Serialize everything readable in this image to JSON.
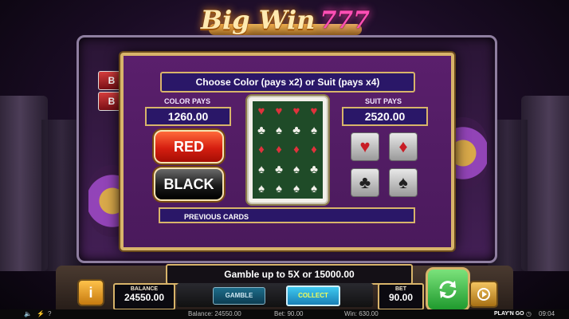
{
  "logo": {
    "text": "Big Win",
    "sevens": "777"
  },
  "side_tiles": [
    "B",
    "B"
  ],
  "panel": {
    "title": "Choose Color (pays x2) or Suit (pays x4)",
    "color_pays_label": "COLOR PAYS",
    "color_pays_value": "1260.00",
    "suit_pays_label": "SUIT PAYS",
    "suit_pays_value": "2520.00",
    "red_label": "RED",
    "black_label": "BLACK",
    "previous_cards_label": "PREVIOUS CARDS",
    "suits": [
      {
        "name": "hearts",
        "glyph": "♥",
        "color": "#c81d25"
      },
      {
        "name": "diamonds",
        "glyph": "♦",
        "color": "#c81d25"
      },
      {
        "name": "clubs",
        "glyph": "♣",
        "color": "#222222"
      },
      {
        "name": "spades",
        "glyph": "♠",
        "color": "#222222"
      }
    ]
  },
  "controls": {
    "gamble_message": "Gamble up to 5X or 15000.00",
    "balance_label": "BALANCE",
    "balance_value": "24550.00",
    "bet_label": "BET",
    "bet_value": "90.00",
    "gamble_button": "GAMBLE",
    "collect_button": "COLLECT",
    "info_button": "i"
  },
  "status_bar": {
    "balance": "Balance: 24550.00",
    "bet": "Bet: 90.00",
    "win": "Win: 630.00",
    "help": "?",
    "time": "09:04",
    "brand": "PLAY'N GO"
  },
  "colors": {
    "gold": "#d8b46a",
    "panel": "#4a1a5c",
    "banner": "#2a1768",
    "red": "#d51e10",
    "spin": "#1f9a2e"
  }
}
